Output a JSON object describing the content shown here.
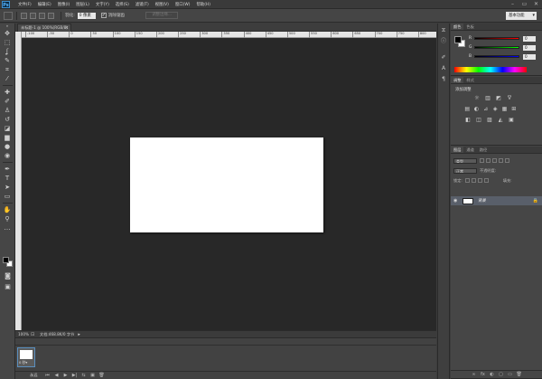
{
  "app": {
    "logo": "Ps",
    "menu": [
      "文件(F)",
      "编辑(E)",
      "图像(I)",
      "图层(L)",
      "文字(Y)",
      "选择(S)",
      "滤镜(T)",
      "视图(V)",
      "窗口(W)",
      "帮助(H)"
    ],
    "window_controls": [
      "–",
      "▭",
      "✕"
    ]
  },
  "options_bar": {
    "feather_label": "羽化:",
    "feather_value": "0 像素",
    "antialias_label": "消除锯齿",
    "antialias_checked": true,
    "refine_edge_label": "调整边缘...",
    "workspace": "基本功能"
  },
  "document": {
    "tab_title": "未标题-1 @ 100%(RGB/8)",
    "ruler_ticks": [
      "-100",
      "-50",
      "0",
      "50",
      "100",
      "150",
      "200",
      "250",
      "300",
      "350",
      "400",
      "450",
      "500",
      "550",
      "600",
      "650",
      "700",
      "750",
      "800"
    ],
    "canvas_color": "#ffffff",
    "workspace_bg": "#282828"
  },
  "status": {
    "zoom": "100%",
    "doc_info": "文档:468.8K/0 字节"
  },
  "timeline": {
    "frame_delay": "0 秒▾",
    "loop": "永远",
    "buttons": [
      "⏮",
      "◀",
      "▶",
      "▶|",
      "⇆",
      "▣",
      "🗑"
    ]
  },
  "color_panel": {
    "tabs": [
      "颜色",
      "色板"
    ],
    "sliders": [
      {
        "label": "R",
        "value": "0",
        "color": "#ff0000"
      },
      {
        "label": "G",
        "value": "0",
        "color": "#00ff00"
      },
      {
        "label": "B",
        "value": "0",
        "color": "#0000ff"
      }
    ]
  },
  "adjustments_panel": {
    "tabs": [
      "调整",
      "样式"
    ],
    "title": "添加调整",
    "row1": [
      "☼",
      "▥",
      "◩",
      "∇"
    ],
    "row2": [
      "▤",
      "◐",
      "⊿",
      "◈",
      "▦",
      "⊞"
    ],
    "row3": [
      "◧",
      "◫",
      "▨",
      "◭",
      "▣"
    ]
  },
  "layers_panel": {
    "tabs": [
      "图层",
      "通道",
      "路径"
    ],
    "kind_filter": "类型",
    "blend_mode": "正常",
    "opacity_label": "不透明度:",
    "lock_label": "锁定:",
    "fill_label": "填充:",
    "layer_name": "背景",
    "footer": [
      "∞",
      "fx",
      "◐",
      "▢",
      "▭",
      "🗑"
    ]
  },
  "colors": {
    "accent": "#5a8fbf",
    "selected_layer": "#595f6a"
  }
}
